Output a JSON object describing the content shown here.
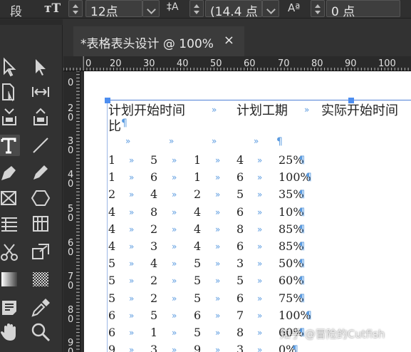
{
  "control_bar": {
    "para_label": "段",
    "font_size": "12点",
    "leading": "(14.4 点",
    "baseline_shift": "0 点"
  },
  "document_tab": {
    "title": "*表格表头设计 @ 100%",
    "close": "×"
  },
  "ruler": {
    "h_ticks": [
      "0",
      "20",
      "30",
      "40",
      "50",
      "60",
      "70",
      "80",
      "90",
      "100"
    ],
    "v_ticks": [
      "0",
      "2\n0",
      "3\n0",
      "4\n0",
      "5\n0",
      "6\n0",
      "7\n0",
      "8\n0",
      "9\n0"
    ]
  },
  "table": {
    "header": [
      "计划开始时间",
      "计划工期",
      "实际开始时间"
    ],
    "header_wrap": "比",
    "rows": [
      [
        "1",
        "5",
        "1",
        "4",
        "25%"
      ],
      [
        "1",
        "6",
        "1",
        "6",
        "100%"
      ],
      [
        "2",
        "4",
        "2",
        "5",
        "35%"
      ],
      [
        "4",
        "8",
        "4",
        "6",
        "10%"
      ],
      [
        "4",
        "2",
        "4",
        "8",
        "85%"
      ],
      [
        "4",
        "3",
        "4",
        "6",
        "85%"
      ],
      [
        "5",
        "4",
        "5",
        "3",
        "50%"
      ],
      [
        "5",
        "2",
        "5",
        "5",
        "60%"
      ],
      [
        "5",
        "2",
        "5",
        "6",
        "75%"
      ],
      [
        "6",
        "5",
        "6",
        "7",
        "100%"
      ],
      [
        "6",
        "1",
        "5",
        "8",
        "60%"
      ],
      [
        "9",
        "3",
        "9",
        "3",
        "0%"
      ]
    ],
    "tab_mark": "»",
    "para_mark": "¶"
  },
  "watermark": "知乎 @冒险的Cutfish",
  "colors": {
    "accent": "#4d8ef0",
    "marks": "#5b9be0"
  }
}
